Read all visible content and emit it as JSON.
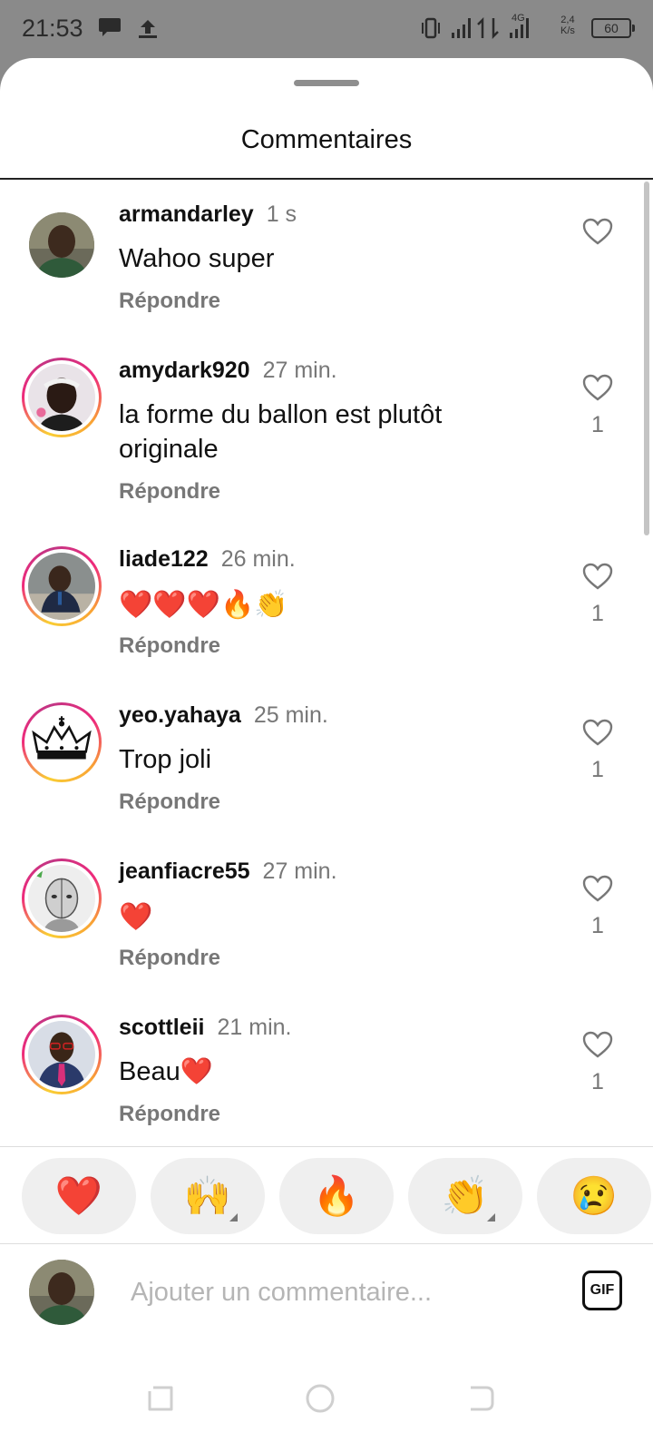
{
  "status_bar": {
    "time": "21:53",
    "network_type": "4G",
    "speed_value": "2,4",
    "speed_unit": "K/s",
    "battery": "60"
  },
  "sheet": {
    "title": "Commentaires"
  },
  "comments": [
    {
      "username": "armandarley",
      "time": "1 s",
      "text": "Wahoo super",
      "reply_label": "Répondre",
      "likes": "",
      "avatar": "avatar-photo-man-green-shirt",
      "story_ring": false
    },
    {
      "username": "amydark920",
      "time": "27 min.",
      "text": "la forme du ballon est plutôt originale",
      "reply_label": "Répondre",
      "likes": "1",
      "avatar": "avatar-photo-woman-headband",
      "story_ring": true
    },
    {
      "username": "liade122",
      "time": "26 min.",
      "text": "❤️❤️❤️🔥👏",
      "reply_label": "Répondre",
      "likes": "1",
      "avatar": "avatar-photo-man-suit-desk",
      "story_ring": true
    },
    {
      "username": "yeo.yahaya",
      "time": "25 min.",
      "text": "Trop joli",
      "reply_label": "Répondre",
      "likes": "1",
      "avatar": "crown-icon",
      "story_ring": true
    },
    {
      "username": "jeanfiacre55",
      "time": "27 min.",
      "text": "❤️",
      "reply_label": "Répondre",
      "likes": "1",
      "avatar": "avatar-photo-man-sketch",
      "story_ring": true
    },
    {
      "username": "scottleii",
      "time": "21 min.",
      "text": "Beau❤️",
      "reply_label": "Répondre",
      "likes": "1",
      "avatar": "avatar-photo-man-glasses-tie",
      "story_ring": true
    }
  ],
  "reactions": [
    {
      "emoji": "❤️",
      "name": "heart",
      "has_options": false
    },
    {
      "emoji": "🙌",
      "name": "raising-hands",
      "has_options": true
    },
    {
      "emoji": "🔥",
      "name": "fire",
      "has_options": false
    },
    {
      "emoji": "👏",
      "name": "clapping-hands",
      "has_options": true
    },
    {
      "emoji": "😢",
      "name": "crying-face",
      "has_options": false
    }
  ],
  "composer": {
    "placeholder": "Ajouter un commentaire...",
    "gif_label": "GIF"
  },
  "colors": {
    "ring_yellow": "#f9ce34",
    "ring_pink": "#ee2a7b",
    "ring_purple": "#c13584",
    "muted_text": "#777777",
    "status_bar_bg": "#8a8a8a"
  }
}
